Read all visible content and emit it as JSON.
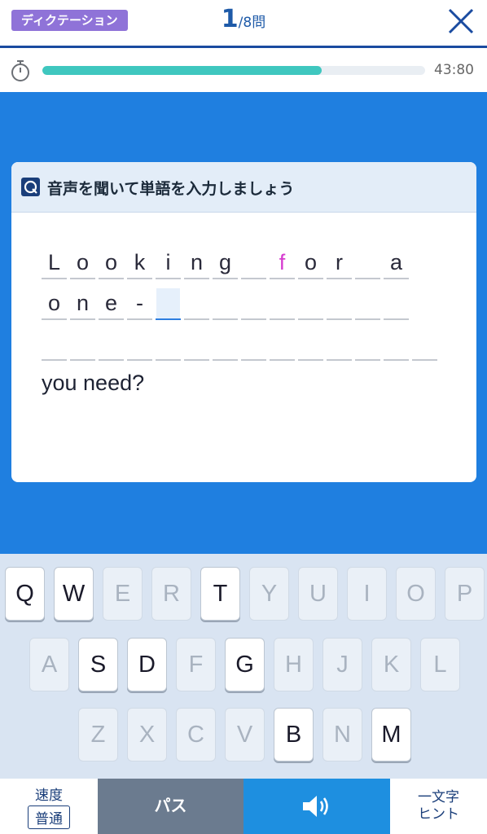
{
  "header": {
    "mode_badge": "ディクテーション",
    "current": "1",
    "total": "/8問",
    "close_icon": "close-icon"
  },
  "timer": {
    "icon": "stopwatch-icon",
    "remaining": "43:80",
    "progress_fraction": 0.73,
    "progress_color": "#3fc7bf"
  },
  "card": {
    "icon": "dictation-icon",
    "instruction": "音声を聞いて単語を入力しましょう",
    "lines": [
      {
        "cells": [
          {
            "ch": "L"
          },
          {
            "ch": "o"
          },
          {
            "ch": "o"
          },
          {
            "ch": "k"
          },
          {
            "ch": "i"
          },
          {
            "ch": "n"
          },
          {
            "ch": "g"
          },
          {
            "ch": ""
          },
          {
            "ch": "f",
            "highlight": true
          },
          {
            "ch": "o"
          },
          {
            "ch": "r"
          },
          {
            "ch": ""
          },
          {
            "ch": "a"
          }
        ]
      },
      {
        "cells": [
          {
            "ch": "o"
          },
          {
            "ch": "n"
          },
          {
            "ch": "e"
          },
          {
            "ch": "-"
          },
          {
            "ch": "",
            "active": true
          },
          {
            "ch": ""
          },
          {
            "ch": ""
          },
          {
            "ch": ""
          },
          {
            "ch": ""
          },
          {
            "ch": ""
          },
          {
            "ch": ""
          },
          {
            "ch": ""
          },
          {
            "ch": ""
          }
        ]
      },
      {
        "cells": [
          {
            "ch": ""
          },
          {
            "ch": ""
          },
          {
            "ch": ""
          },
          {
            "ch": ""
          },
          {
            "ch": ""
          },
          {
            "ch": ""
          },
          {
            "ch": ""
          },
          {
            "ch": ""
          },
          {
            "ch": ""
          },
          {
            "ch": ""
          },
          {
            "ch": ""
          },
          {
            "ch": ""
          },
          {
            "ch": ""
          },
          {
            "ch": ""
          }
        ]
      }
    ],
    "tail_text": "you need?",
    "highlight_color": "#d63ccf"
  },
  "keyboard": {
    "rows": [
      [
        {
          "k": "Q",
          "on": true
        },
        {
          "k": "W",
          "on": true
        },
        {
          "k": "E",
          "on": false
        },
        {
          "k": "R",
          "on": false
        },
        {
          "k": "T",
          "on": true
        },
        {
          "k": "Y",
          "on": false
        },
        {
          "k": "U",
          "on": false
        },
        {
          "k": "I",
          "on": false
        },
        {
          "k": "O",
          "on": false
        },
        {
          "k": "P",
          "on": false
        }
      ],
      [
        {
          "k": "A",
          "on": false
        },
        {
          "k": "S",
          "on": true
        },
        {
          "k": "D",
          "on": true
        },
        {
          "k": "F",
          "on": false
        },
        {
          "k": "G",
          "on": true
        },
        {
          "k": "H",
          "on": false
        },
        {
          "k": "J",
          "on": false
        },
        {
          "k": "K",
          "on": false
        },
        {
          "k": "L",
          "on": false
        }
      ],
      [
        {
          "k": "Z",
          "on": false
        },
        {
          "k": "X",
          "on": false
        },
        {
          "k": "C",
          "on": false
        },
        {
          "k": "V",
          "on": false
        },
        {
          "k": "B",
          "on": true
        },
        {
          "k": "N",
          "on": false
        },
        {
          "k": "M",
          "on": true
        }
      ]
    ]
  },
  "bottom": {
    "speed_label": "速度",
    "speed_value": "普通",
    "pass_label": "パス",
    "sound_icon": "speaker-icon",
    "hint_line1": "一文字",
    "hint_line2": "ヒント"
  }
}
